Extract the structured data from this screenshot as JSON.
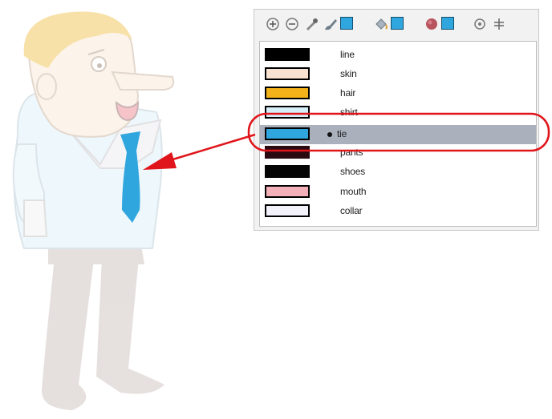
{
  "toolbar": {
    "icons": [
      "add-color-icon",
      "remove-color-icon",
      "color-picker-icon",
      "brush-icon",
      "paint-bucket-icon",
      "texture-icon",
      "options-icon",
      "palette-menu-icon"
    ],
    "chip_color": "#2fa6dd"
  },
  "palette": {
    "colors": [
      {
        "name": "line",
        "swatch": "#000000"
      },
      {
        "name": "skin",
        "swatch": "#f8e3d2"
      },
      {
        "name": "hair",
        "swatch": "#f3b21a"
      },
      {
        "name": "shirt",
        "swatch": "#d6eef8"
      },
      {
        "name": "tie",
        "swatch": "#2fa6dd"
      },
      {
        "name": "pants",
        "swatch": "#2a0a10"
      },
      {
        "name": "shoes",
        "swatch": "#050505"
      },
      {
        "name": "mouth",
        "swatch": "#f4b0b8"
      },
      {
        "name": "collar",
        "swatch": "#f3f1fa"
      }
    ],
    "selected": "tie",
    "selected_row_color": "#aab1bd"
  },
  "annotation": {
    "highlight_color": "#e0151b"
  }
}
